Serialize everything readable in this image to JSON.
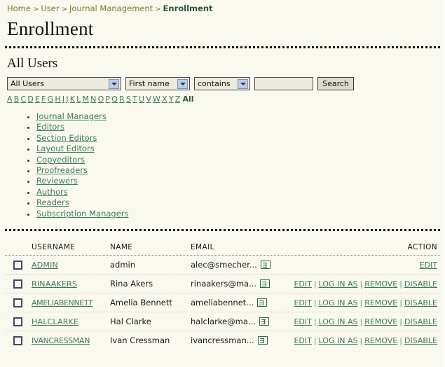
{
  "breadcrumb": {
    "items": [
      {
        "label": "Home",
        "current": false
      },
      {
        "label": "User",
        "current": false
      },
      {
        "label": "Journal Management",
        "current": false
      },
      {
        "label": "Enrollment",
        "current": true
      }
    ],
    "separator": ">"
  },
  "page": {
    "title": "Enrollment",
    "section_title": "All Users"
  },
  "search": {
    "user_group": "All Users",
    "field": "First name",
    "match": "contains",
    "query": "",
    "query_placeholder": "",
    "button_label": "Search"
  },
  "alphabet": {
    "letters": [
      "A",
      "B",
      "C",
      "D",
      "E",
      "F",
      "G",
      "H",
      "I",
      "J",
      "K",
      "L",
      "M",
      "N",
      "O",
      "P",
      "Q",
      "R",
      "S",
      "T",
      "U",
      "V",
      "W",
      "X",
      "Y",
      "Z"
    ],
    "all_label": "All"
  },
  "roles": [
    {
      "label": "Journal Managers"
    },
    {
      "label": "Editors"
    },
    {
      "label": "Section Editors"
    },
    {
      "label": "Layout Editors"
    },
    {
      "label": "Copyeditors"
    },
    {
      "label": "Proofreaders"
    },
    {
      "label": "Reviewers"
    },
    {
      "label": "Authors"
    },
    {
      "label": "Readers"
    },
    {
      "label": "Subscription Managers"
    }
  ],
  "table": {
    "columns": {
      "username": "USERNAME",
      "name": "NAME",
      "email": "EMAIL",
      "action": "ACTION"
    },
    "action_labels": {
      "edit": "EDIT",
      "log_in_as": "LOG IN AS",
      "remove": "REMOVE",
      "disable": "DISABLE"
    },
    "separator": "|",
    "rows": [
      {
        "username": "ADMIN",
        "name": "admin",
        "email": "alec@smecher...",
        "email_icon": "mail-icon",
        "actions": [
          "EDIT"
        ]
      },
      {
        "username": "RINAAKERS",
        "name": "Rina Akers",
        "email": "rinaakers@ma...",
        "email_icon": "mail-icon",
        "actions": [
          "EDIT",
          "LOG IN AS",
          "REMOVE",
          "DISABLE"
        ]
      },
      {
        "username": "AMELIABENNETT",
        "name": "Amelia Bennett",
        "email": "ameliabennet...",
        "email_icon": "mail-icon",
        "actions": [
          "EDIT",
          "LOG IN AS",
          "REMOVE",
          "DISABLE"
        ]
      },
      {
        "username": "HALCLARKE",
        "name": "Hal Clarke",
        "email": "halclarke@ma...",
        "email_icon": "mail-icon",
        "actions": [
          "EDIT",
          "LOG IN AS",
          "REMOVE",
          "DISABLE"
        ]
      },
      {
        "username": "IVANCRESSMAN",
        "name": "Ivan Cressman",
        "email": "ivancressman...",
        "email_icon": "mail-icon",
        "actions": [
          "EDIT",
          "LOG IN AS",
          "REMOVE",
          "DISABLE"
        ]
      }
    ]
  },
  "colors": {
    "page_background": "#faf9ef",
    "link_green": "#3e7a5e",
    "breadcrumb_olive": "#7a7a2e",
    "breadcrumb_current": "#27543f",
    "rule_dark": "#14130e",
    "checkbox_border": "#3c4a63",
    "select_arrow": "#bdcbe8"
  }
}
